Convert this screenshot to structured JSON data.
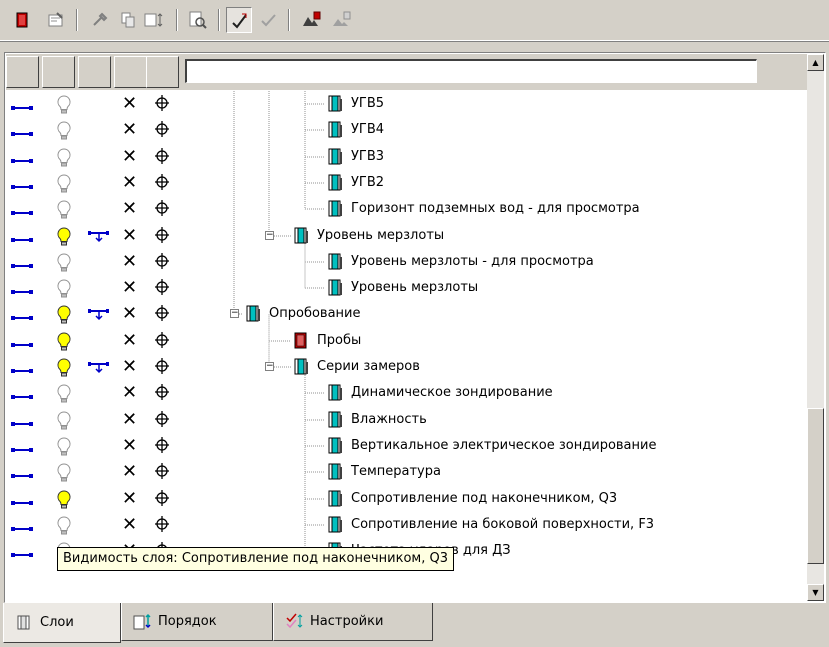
{
  "toolbar": {
    "buttons": [
      {
        "icon": "red-layer-icon"
      },
      {
        "icon": "properties-icon"
      },
      {
        "icon": "tools-icon"
      },
      {
        "icon": "copy-icon"
      },
      {
        "icon": "sort-icon"
      },
      {
        "icon": "find-icon"
      },
      {
        "icon": "check-brush-icon",
        "active": true
      },
      {
        "icon": "checkmark-icon"
      },
      {
        "icon": "layer-settings-icon"
      },
      {
        "icon": "layer-filter-icon"
      }
    ]
  },
  "search": {
    "value": ""
  },
  "rows": [
    {
      "label": "УГВ5",
      "indent": 4,
      "bulb_on": false,
      "filter": false,
      "icon": "layer"
    },
    {
      "label": "УГВ4",
      "indent": 4,
      "bulb_on": false,
      "filter": false,
      "icon": "layer"
    },
    {
      "label": "УГВ3",
      "indent": 4,
      "bulb_on": false,
      "filter": false,
      "icon": "layer"
    },
    {
      "label": "УГВ2",
      "indent": 4,
      "bulb_on": false,
      "filter": false,
      "icon": "layer"
    },
    {
      "label": "Горизонт подземных вод - для просмотра",
      "indent": 4,
      "bulb_on": false,
      "filter": false,
      "icon": "layer"
    },
    {
      "label": "Уровень мерзлоты",
      "indent": 3,
      "bulb_on": true,
      "filter": true,
      "icon": "layer",
      "expander": "−"
    },
    {
      "label": "Уровень мерзлоты - для просмотра",
      "indent": 4,
      "bulb_on": false,
      "filter": false,
      "icon": "layer"
    },
    {
      "label": "Уровень мерзлоты",
      "indent": 4,
      "bulb_on": false,
      "filter": false,
      "icon": "layer"
    },
    {
      "label": "Опробование",
      "indent": 2,
      "bulb_on": true,
      "filter": true,
      "icon": "layer",
      "expander": "−"
    },
    {
      "label": "Пробы",
      "indent": 3,
      "bulb_on": true,
      "filter": false,
      "icon": "red"
    },
    {
      "label": "Серии замеров",
      "indent": 3,
      "bulb_on": true,
      "filter": true,
      "icon": "layer",
      "expander": "−"
    },
    {
      "label": "Динамическое зондирование",
      "indent": 4,
      "bulb_on": false,
      "filter": false,
      "icon": "layer"
    },
    {
      "label": "Влажность",
      "indent": 4,
      "bulb_on": false,
      "filter": false,
      "icon": "layer"
    },
    {
      "label": "Вертикальное электрическое зондирование",
      "indent": 4,
      "bulb_on": false,
      "filter": false,
      "icon": "layer"
    },
    {
      "label": "Температура",
      "indent": 4,
      "bulb_on": false,
      "filter": false,
      "icon": "layer"
    },
    {
      "label": "Сопротивление под наконечником, Q3",
      "indent": 4,
      "bulb_on": true,
      "filter": false,
      "icon": "layer"
    },
    {
      "label": "Сопротивление на боковой поверхности, F3",
      "indent": 4,
      "bulb_on": false,
      "filter": false,
      "icon": "layer"
    },
    {
      "label": "Частота ударов для ДЗ",
      "indent": 4,
      "bulb_on": false,
      "filter": false,
      "icon": "layer"
    }
  ],
  "tooltip": {
    "text": "Видимость слоя: Сопротивление под наконечником, Q3"
  },
  "tabs": [
    {
      "label": "Слои",
      "icon": "layers-tab-icon",
      "active": true
    },
    {
      "label": "Порядок",
      "icon": "order-tab-icon",
      "active": false
    },
    {
      "label": "Настройки",
      "icon": "settings-tab-icon",
      "active": false
    }
  ],
  "colors": {
    "link": "#0000c8",
    "bulb_on": "#ffff00",
    "layer": "#00c0c0",
    "red": "#c00000"
  }
}
